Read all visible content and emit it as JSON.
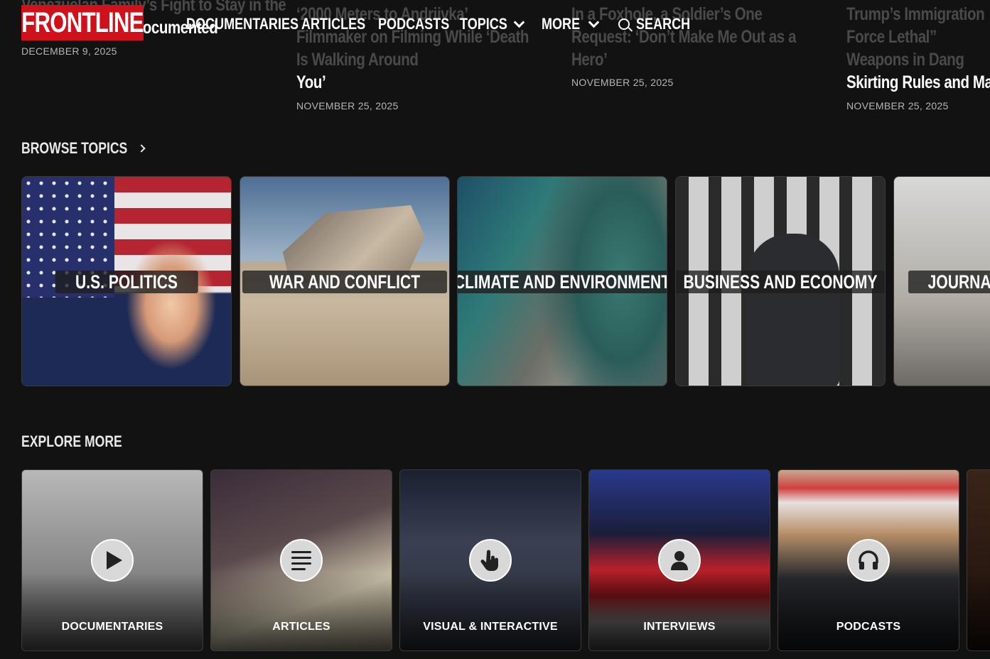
{
  "articles": [
    {
      "faded": "Venezuelan Family’s Fight to Stay in the",
      "title": "U.S. — and Stay Documented",
      "date": "DECEMBER 9, 2025"
    },
    {
      "faded": "‘2000 Meters to Andriivka’ Filmmaker on Filming While ‘Death Is Walking Around",
      "title": "You’",
      "date": "NOVEMBER 25, 2025"
    },
    {
      "faded": "In a Foxhole, a Soldier’s One Request: ‘Don’t Make Me Out as a Hero’",
      "title": "",
      "date": "NOVEMBER 25, 2025"
    },
    {
      "faded": "Trump’s Immigration Force Lethal” Weapons in Dang",
      "title": "Skirting Rules and Maimi",
      "date": "NOVEMBER 25, 2025"
    }
  ],
  "header": {
    "logo": "FRONTLINE",
    "nav": [
      "DOCUMENTARIES",
      "ARTICLES",
      "PODCASTS",
      "TOPICS",
      "MORE"
    ],
    "search": "SEARCH"
  },
  "browse": {
    "heading": "BROWSE TOPICS",
    "topics": [
      "U.S. POLITICS",
      "WAR AND CONFLICT",
      "CLIMATE AND ENVIRONMENT",
      "BUSINESS AND ECONOMY",
      "JOURNALISM"
    ]
  },
  "explore": {
    "heading": "EXPLORE MORE",
    "items": [
      {
        "label": "DOCUMENTARIES",
        "icon": "play-icon"
      },
      {
        "label": "ARTICLES",
        "icon": "text-lines-icon"
      },
      {
        "label": "VISUAL & INTERACTIVE",
        "icon": "pointer-hand-icon"
      },
      {
        "label": "INTERVIEWS",
        "icon": "person-icon"
      },
      {
        "label": "PODCASTS",
        "icon": "headphones-icon"
      }
    ]
  },
  "colors": {
    "background": "#121212",
    "brand_red": "#d0111b",
    "text_muted": "#b5b5b5"
  }
}
